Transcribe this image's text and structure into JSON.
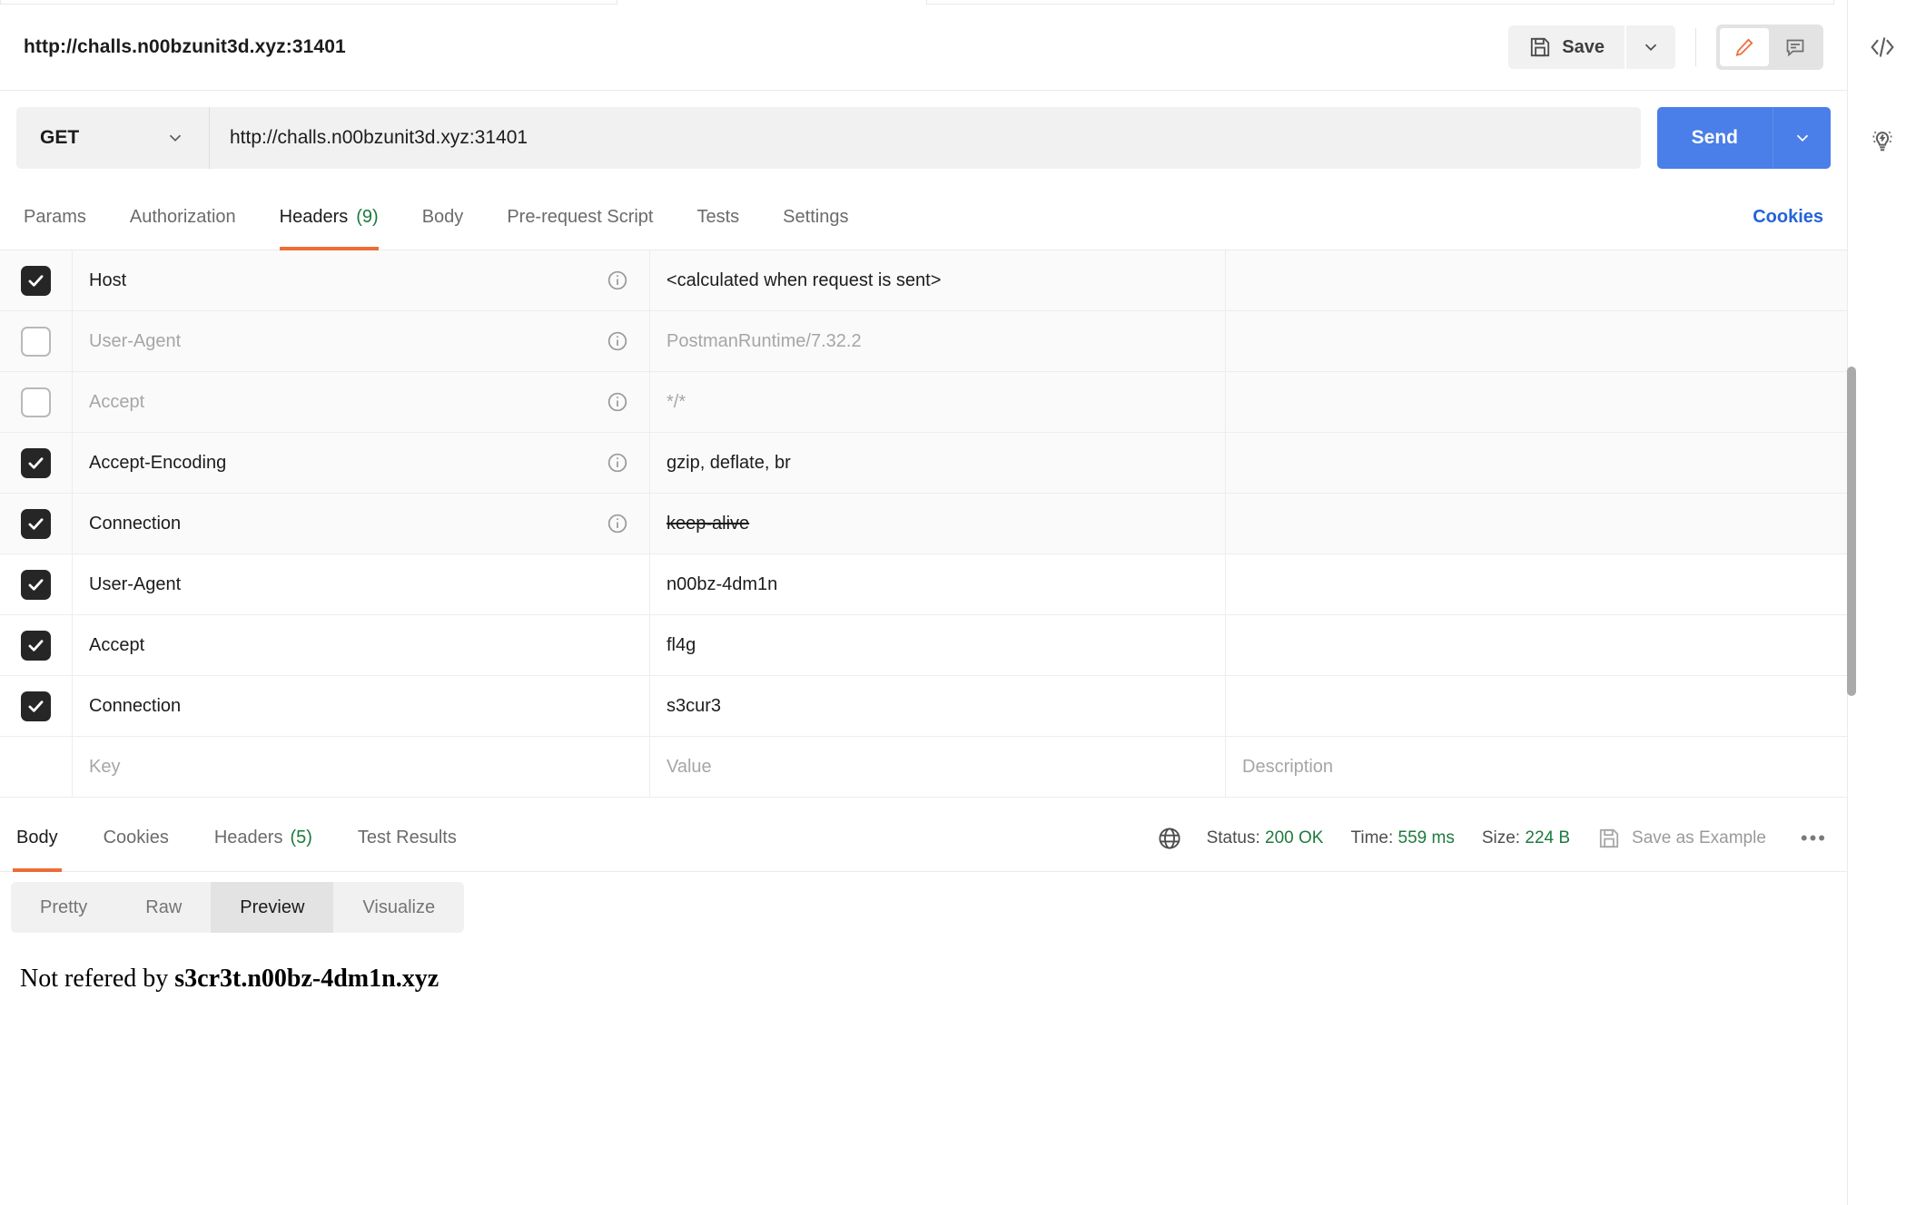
{
  "request": {
    "title": "http://challs.n00bzunit3d.xyz:31401",
    "save_label": "Save",
    "method": "GET",
    "url": "http://challs.n00bzunit3d.xyz:31401",
    "send_label": "Send",
    "icons": {
      "save": "floppy-disk-icon",
      "save_caret": "chevron-down-icon",
      "edit": "pencil-icon",
      "comment": "comment-icon",
      "method_caret": "chevron-down-icon",
      "send_caret": "chevron-down-icon"
    },
    "tabs": [
      {
        "label": "Params",
        "count": "",
        "active": false
      },
      {
        "label": "Authorization",
        "count": "",
        "active": false
      },
      {
        "label": "Headers",
        "count": "(9)",
        "active": true
      },
      {
        "label": "Body",
        "count": "",
        "active": false
      },
      {
        "label": "Pre-request Script",
        "count": "",
        "active": false
      },
      {
        "label": "Tests",
        "count": "",
        "active": false
      },
      {
        "label": "Settings",
        "count": "",
        "active": false
      }
    ],
    "cookies_link": "Cookies"
  },
  "headers_table": {
    "placeholders": {
      "key": "Key",
      "value": "Value",
      "description": "Description"
    },
    "rows": [
      {
        "checked": true,
        "system": true,
        "dim": false,
        "key": "Host",
        "value": "<calculated when request is sent>",
        "info": true,
        "strike": false
      },
      {
        "checked": false,
        "system": true,
        "dim": true,
        "key": "User-Agent",
        "value": "PostmanRuntime/7.32.2",
        "info": true,
        "strike": false
      },
      {
        "checked": false,
        "system": true,
        "dim": true,
        "key": "Accept",
        "value": "*/*",
        "info": true,
        "strike": false
      },
      {
        "checked": true,
        "system": true,
        "dim": false,
        "key": "Accept-Encoding",
        "value": "gzip, deflate, br",
        "info": true,
        "strike": false
      },
      {
        "checked": true,
        "system": true,
        "dim": false,
        "key": "Connection",
        "value": "keep-alive",
        "info": true,
        "strike": true
      },
      {
        "checked": true,
        "system": false,
        "dim": false,
        "key": "User-Agent",
        "value": "n00bz-4dm1n",
        "info": false,
        "strike": false
      },
      {
        "checked": true,
        "system": false,
        "dim": false,
        "key": "Accept",
        "value": "fl4g",
        "info": false,
        "strike": false
      },
      {
        "checked": true,
        "system": false,
        "dim": false,
        "key": "Connection",
        "value": "s3cur3",
        "info": false,
        "strike": false
      }
    ]
  },
  "response": {
    "tabs": [
      {
        "label": "Body",
        "count": "",
        "active": true
      },
      {
        "label": "Cookies",
        "count": "",
        "active": false
      },
      {
        "label": "Headers",
        "count": "(5)",
        "active": false
      },
      {
        "label": "Test Results",
        "count": "",
        "active": false
      }
    ],
    "status_label": "Status:",
    "status_value": "200 OK",
    "time_label": "Time:",
    "time_value": "559 ms",
    "size_label": "Size:",
    "size_value": "224 B",
    "save_example_label": "Save as Example",
    "more_label": "•••",
    "icons": {
      "globe": "globe-icon",
      "save_example": "floppy-disk-icon",
      "more": "more-options-icon"
    },
    "view_modes": [
      {
        "label": "Pretty",
        "active": false
      },
      {
        "label": "Raw",
        "active": false
      },
      {
        "label": "Preview",
        "active": true
      },
      {
        "label": "Visualize",
        "active": false
      }
    ],
    "body_prefix": "Not refered by ",
    "body_bold": "s3cr3t.n00bz-4dm1n.xyz"
  },
  "right_rail": {
    "items": [
      {
        "icon": "code-icon"
      },
      {
        "icon": "lightbulb-bolt-icon"
      }
    ]
  },
  "colors": {
    "accent_orange": "#ef6c37",
    "send_blue": "#4a7ee8",
    "link_blue": "#2563d6",
    "success_green": "#1d7a3d",
    "checkbox_dark": "#262626"
  }
}
